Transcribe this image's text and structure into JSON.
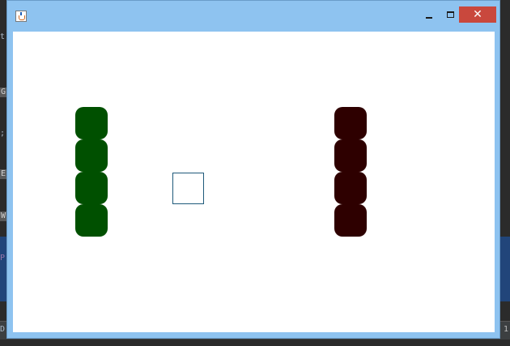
{
  "ide_background": {
    "fragments": [
      "t",
      "G",
      ";",
      "E",
      "W",
      "P",
      "D"
    ],
    "status_right_text": "1"
  },
  "window": {
    "title": "",
    "controls": {
      "minimize_label": "",
      "maximize_label": "",
      "close_label": "✕"
    }
  },
  "canvas": {
    "background_color": "#ffffff",
    "player_left": {
      "color": "#005000",
      "segments": 4
    },
    "player_right": {
      "color": "#2e0000",
      "segments": 4
    },
    "center_square": {
      "border_color": "#1f5a7a",
      "fill_color": "#ffffff"
    }
  },
  "colors": {
    "titlebar": "#8ec3f0",
    "close_button": "#c9483d",
    "ide_background": "#2b2b2b",
    "ide_selection_band": "#21457a"
  }
}
